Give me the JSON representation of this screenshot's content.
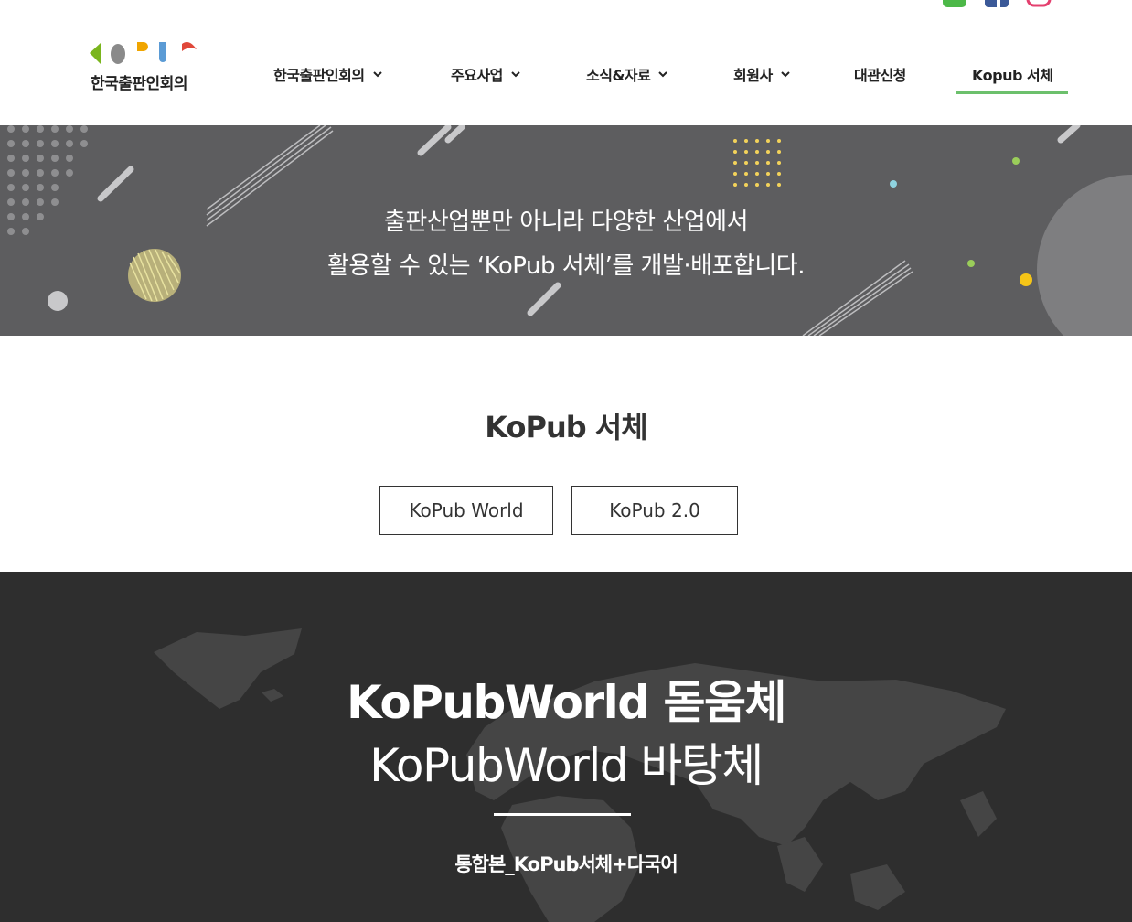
{
  "header": {
    "logo_text": "한국출판인회의",
    "social": [
      {
        "icon": "kakao-story-icon",
        "color": "#4cb848"
      },
      {
        "icon": "facebook-icon",
        "color": "#3b5998"
      },
      {
        "icon": "instagram-icon",
        "color": "#e1306c"
      }
    ],
    "nav": [
      {
        "label": "한국출판인회의",
        "has_dropdown": true
      },
      {
        "label": "주요사업",
        "has_dropdown": true
      },
      {
        "label": "소식&자료",
        "has_dropdown": true
      },
      {
        "label": "회원사",
        "has_dropdown": true
      },
      {
        "label": "대관신청",
        "has_dropdown": false
      },
      {
        "label": "Kopub 서체",
        "has_dropdown": false,
        "active": true
      }
    ],
    "active_color": "#6cc06c"
  },
  "banner": {
    "line1": "출판산업뿐만 아니라 다양한 산업에서",
    "line2": "활용할 수 있는 ‘KoPub 서체’를 개발·배포합니다."
  },
  "section": {
    "title": "KoPub 서체",
    "buttons": [
      "KoPub World",
      "KoPub 2.0"
    ]
  },
  "world": {
    "font_bold": "KoPubWorld 돋움체",
    "font_regular": "KoPubWorld 바탕체",
    "download_label": "통합본_KoPub서체+다국어"
  }
}
